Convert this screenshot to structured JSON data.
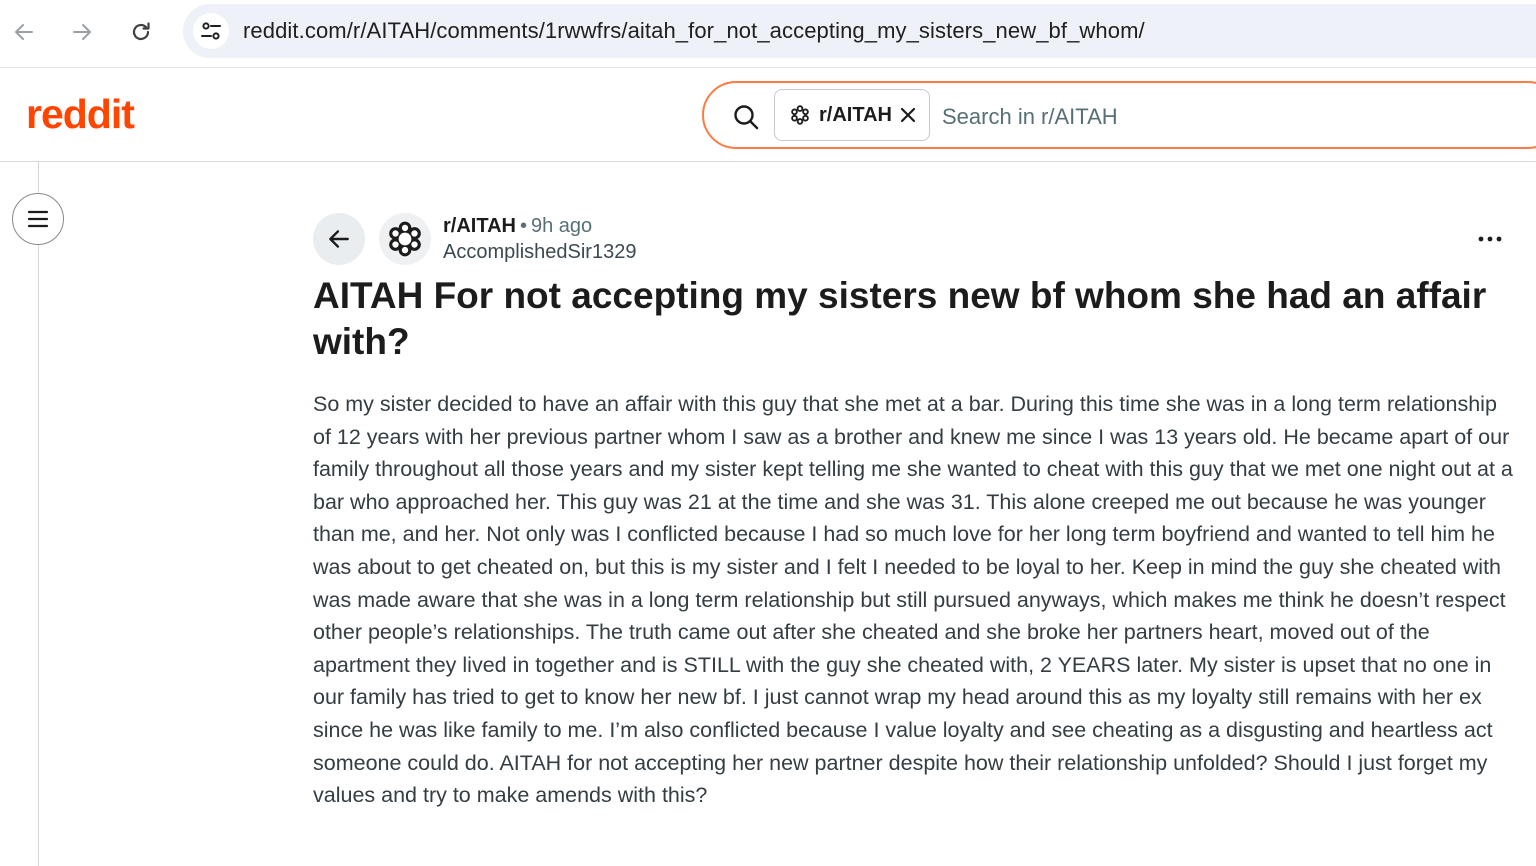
{
  "browser": {
    "url": "reddit.com/r/AITAH/comments/1rwwfrs/aitah_for_not_accepting_my_sisters_new_bf_whom/"
  },
  "header": {
    "logo_text": "reddit",
    "brand_color": "#ff4500",
    "search": {
      "community_chip": "r/AITAH",
      "placeholder": "Search in r/AITAH"
    }
  },
  "post": {
    "subreddit": "r/AITAH",
    "separator": "•",
    "age": "9h ago",
    "author": "AccomplishedSir1329",
    "title": "AITAH For not accepting my sisters new bf whom she had an affair with?",
    "body": "So my sister decided to have an affair with this guy that she met at a bar. During this time she was in a long term relationship of 12 years with her previous partner whom I saw as a brother and knew me since I was 13 years old. He became apart of our family throughout all those years and my sister kept telling me she wanted to cheat with this guy that we met one night out at a bar who approached her. This guy was 21 at the time and she was 31. This alone creeped me out because he was younger than me, and her. Not only was I conflicted because I had so much love for her long term boyfriend and wanted to tell him he was about to get cheated on, but this is my sister and I felt I needed to be loyal to her. Keep in mind the guy she cheated with was made aware that she was in a long term relationship but still pursued anyways, which makes me think he doesn’t respect other people’s relationships. The truth came out after she cheated and she broke her partners heart, moved out of the apartment they lived in together and is STILL with the guy she cheated with, 2 YEARS later. My sister is upset that no one in our family has tried to get to know her new bf. I just cannot wrap my head around this as my loyalty still remains with her ex since he was like family to me. I’m also conflicted because I value loyalty and see cheating as a disgusting and heartless act someone could do. AITAH for not accepting her new partner despite how their relationship unfolded? Should I just forget my values and try to make amends with this?"
  },
  "icons": {
    "back": "arrow-left-icon",
    "forward": "arrow-right-icon",
    "reload": "reload-icon",
    "site_info": "tune-icon",
    "search": "search-icon",
    "community": "snoo-flower-icon",
    "close": "close-icon",
    "menu": "hamburger-icon",
    "overflow": "more-horizontal-icon"
  }
}
